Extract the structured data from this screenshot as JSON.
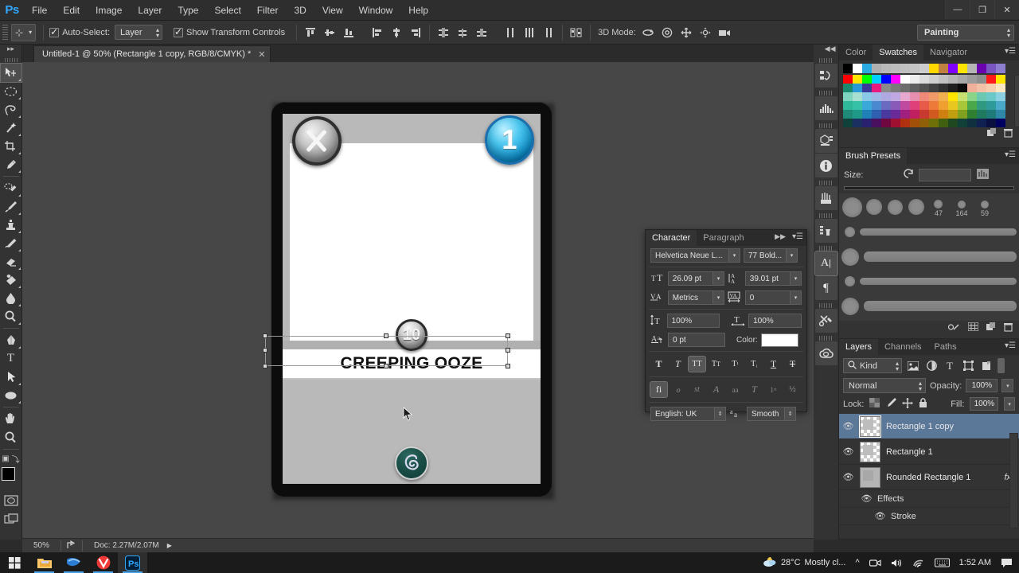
{
  "app": {
    "name": "Ps",
    "logo_color": "#31a8ff"
  },
  "menubar": {
    "items": [
      "File",
      "Edit",
      "Image",
      "Layer",
      "Type",
      "Select",
      "Filter",
      "3D",
      "View",
      "Window",
      "Help"
    ]
  },
  "window_controls": {
    "minimize": "—",
    "restore": "❐",
    "close": "✕"
  },
  "options_bar": {
    "auto_select_label": "Auto-Select:",
    "auto_select_checked": true,
    "auto_select_target": "Layer",
    "show_transform_label": "Show Transform Controls",
    "show_transform_checked": true,
    "align_icons": [
      "align-top-edges-icon",
      "align-vertical-centers-icon",
      "align-bottom-edges-icon",
      "align-left-edges-icon",
      "align-horizontal-centers-icon",
      "align-right-edges-icon"
    ],
    "distribute_icons": [
      "distribute-top-edges-icon",
      "distribute-vertical-centers-icon",
      "distribute-bottom-edges-icon",
      "distribute-left-edges-icon",
      "distribute-horizontal-centers-icon",
      "distribute-right-edges-icon"
    ],
    "auto_align_icon": "auto-align-layers-icon",
    "mode_3d_label": "3D Mode:",
    "mode_3d_icons": [
      "rotate-3d-icon",
      "roll-3d-icon",
      "pan-3d-icon",
      "slide-3d-icon",
      "scale-3d-icon"
    ],
    "workspace": "Painting"
  },
  "document_tab": {
    "title": "Untitled-1 @ 50% (Rectangle 1 copy, RGB/8/CMYK) *",
    "close": "✕"
  },
  "toolbar": {
    "tools": [
      {
        "name": "move-tool",
        "glyph": "✥",
        "active": true
      },
      {
        "name": "elliptical-marquee-tool",
        "glyph": "◯"
      },
      {
        "name": "lasso-tool",
        "glyph": "✒"
      },
      {
        "name": "magic-wand-tool",
        "glyph": "✷"
      },
      {
        "name": "crop-tool",
        "glyph": "⌗"
      },
      {
        "name": "eyedropper-tool",
        "glyph": "✎"
      },
      {
        "name": "spot-healing-brush-tool",
        "glyph": "⌗"
      },
      {
        "name": "brush-tool",
        "glyph": "🖌"
      },
      {
        "name": "clone-stamp-tool",
        "glyph": "⎙"
      },
      {
        "name": "history-brush-tool",
        "glyph": "⌇"
      },
      {
        "name": "eraser-tool",
        "glyph": "▱"
      },
      {
        "name": "gradient-tool",
        "glyph": "◧"
      },
      {
        "name": "blur-tool",
        "glyph": "💧"
      },
      {
        "name": "dodge-tool",
        "glyph": "◉"
      },
      {
        "name": "pen-tool",
        "glyph": "✑"
      },
      {
        "name": "type-tool",
        "glyph": "T"
      },
      {
        "name": "path-selection-tool",
        "glyph": "➤"
      },
      {
        "name": "ellipse-shape-tool",
        "glyph": "⬭"
      },
      {
        "name": "hand-tool",
        "glyph": "✋"
      },
      {
        "name": "zoom-tool",
        "glyph": "🔍"
      }
    ],
    "foreground_color": "#000000",
    "background_color": "#ffffff",
    "quick_mask_icon": "quick-mask-icon",
    "screen_mode_icon": "screen-mode-icon",
    "default_colors_icon": "default-colors-icon",
    "swap_colors_icon": "swap-colors-icon"
  },
  "canvas": {
    "card": {
      "name": "CREEPING OOZE",
      "cost": "1",
      "power": "10",
      "type_icon": "crossed-swords-icon",
      "faction_icon": "ooze-spiral-icon",
      "art_area_color": "#ffffff",
      "frame_color": "#0c0c0c",
      "border_color": "#b9b9b9"
    },
    "selection": {
      "handles": 8,
      "cursor_icon": "text-cursor-icon"
    }
  },
  "status_bar": {
    "zoom": "50%",
    "share_icon": "share-icon",
    "doc_info": "Doc: 2.27M/2.07M",
    "expand_icon": "▶"
  },
  "icon_dock": {
    "collapse_icon": "◀◀",
    "buttons": [
      {
        "name": "history-panel-icon",
        "glyph": "↺"
      },
      {
        "name": "histogram-panel-icon",
        "glyph": "▥"
      },
      {
        "name": "3d-panel-icon",
        "glyph": "◰"
      },
      {
        "name": "info-panel-icon",
        "glyph": "ⓘ"
      },
      {
        "name": "brush-panel-icon",
        "glyph": "🖌"
      },
      {
        "name": "clone-source-panel-icon",
        "glyph": "▤"
      },
      {
        "name": "character-panel-icon",
        "glyph": "A"
      },
      {
        "name": "paragraph-panel-icon",
        "glyph": "¶"
      },
      {
        "name": "tool-presets-panel-icon",
        "glyph": "✂"
      },
      {
        "name": "creative-cloud-icon",
        "glyph": "◎"
      }
    ]
  },
  "swatches_panel": {
    "tabs": [
      "Color",
      "Swatches",
      "Navigator"
    ],
    "active_tab": "Swatches",
    "recent_colors": [
      "#000000",
      "#ffffff",
      "#29abe2",
      "#b0b0b0",
      "#b8b8b8",
      "#bdbdbd",
      "#c0c0c0",
      "#c4c4c4",
      "#cccccc",
      "#ffd800",
      "#c08040",
      "#7f00ff",
      "#ffe400",
      "#b5b5b5",
      "#6a00b0",
      "#7a56c2",
      "#8e7ed0"
    ],
    "grid": [
      [
        "#ff0000",
        "#ffe400",
        "#00ff00",
        "#00d0ff",
        "#0000ff",
        "#ff00ff",
        "#ffffff",
        "#ededed",
        "#dcdcdc",
        "#cfcfcf",
        "#c2c2c2",
        "#b5b5b5",
        "#a8a8a8",
        "#9b9b9b",
        "#8e8e8e",
        "#ff1a1a",
        "#ffe400"
      ],
      [
        "#1a8a6e",
        "#2a9ad6",
        "#3a3a9a",
        "#e8197f",
        "#8a8a8a",
        "#7a7a7a",
        "#6e6e6e",
        "#5f5f5f",
        "#515151",
        "#414141",
        "#313131",
        "#1f1f1f",
        "#0c0c0c",
        "#f0b09a",
        "#f5c0a8",
        "#f7cdb0",
        "#fae6c0"
      ],
      [
        "#7fd4c0",
        "#a7e0d0",
        "#8ac8e8",
        "#9fb8e8",
        "#b0a8e0",
        "#c0a8e0",
        "#e8a8d0",
        "#e88fb0",
        "#f08a78",
        "#f09a6a",
        "#f0b050",
        "#ffe400",
        "#c8e070",
        "#8ad48a",
        "#6ac8b0",
        "#6ac8c8",
        "#8ad0e0"
      ],
      [
        "#2fb89a",
        "#35c0a8",
        "#3aa8d8",
        "#4a88d0",
        "#6a6ac0",
        "#8a5ab8",
        "#c04aa0",
        "#e0407a",
        "#e85a4a",
        "#ee7a3a",
        "#f0a030",
        "#e8c820",
        "#a8c83a",
        "#4aa84a",
        "#2f9a80",
        "#2f9a9a",
        "#4aa8c8"
      ],
      [
        "#1f8a78",
        "#1f9a88",
        "#2080b8",
        "#2f60b0",
        "#4a3aa0",
        "#6a2a98",
        "#a02080",
        "#c02060",
        "#c83a2f",
        "#d05a20",
        "#d08010",
        "#c0a010",
        "#80a020",
        "#2f8030",
        "#1f7a60",
        "#1f7a7a",
        "#2f88a8"
      ],
      [
        "#10403a",
        "#1a3060",
        "#2a2070",
        "#4a1060",
        "#700840",
        "#a01030",
        "#b03010",
        "#a05008",
        "#906008",
        "#707008",
        "#406010",
        "#204820",
        "#104038",
        "#103040",
        "#102050",
        "#0a1040",
        "#000060"
      ]
    ],
    "new_swatch_icon": "new-swatch-icon",
    "delete_icon": "trash-icon"
  },
  "brush_presets_panel": {
    "tab": "Brush Presets",
    "size_label": "Size:",
    "reset_icon": "reset-icon",
    "size_value": "",
    "toggle_icon": "brush-panel-toggle-icon",
    "preset_numbers": [
      "47",
      "164",
      "59"
    ],
    "footer_icons": [
      "new-brush-preset-icon",
      "brush-grid-icon",
      "duplicate-icon",
      "trash-icon"
    ]
  },
  "character_panel": {
    "tabs": [
      "Character",
      "Paragraph"
    ],
    "active_tab": "Character",
    "collapse_icon": "▶▶",
    "menu_icon": "panel-menu-icon",
    "font_family": "Helvetica Neue L...",
    "font_style": "77 Bold...",
    "font_size_icon": "font-size-icon",
    "font_size": "26.09 pt",
    "leading_icon": "leading-icon",
    "leading": "39.01 pt",
    "kerning_icon": "kerning-icon",
    "kerning": "Metrics",
    "tracking_icon": "tracking-icon",
    "tracking": "0",
    "vertical_scale_icon": "vertical-scale-icon",
    "vertical_scale": "100%",
    "horizontal_scale_icon": "horizontal-scale-icon",
    "horizontal_scale": "100%",
    "baseline_icon": "baseline-shift-icon",
    "baseline_shift": "0 pt",
    "color_label": "Color:",
    "color_value": "#ffffff",
    "style_buttons": [
      {
        "name": "faux-bold-button",
        "glyph": "T",
        "on": false
      },
      {
        "name": "faux-italic-button",
        "glyph": "T",
        "on": false
      },
      {
        "name": "all-caps-button",
        "glyph": "TT",
        "on": true
      },
      {
        "name": "small-caps-button",
        "glyph": "Tᴛ",
        "on": false
      },
      {
        "name": "superscript-button",
        "glyph": "T¹",
        "on": false
      },
      {
        "name": "subscript-button",
        "glyph": "T₁",
        "on": false
      },
      {
        "name": "underline-button",
        "glyph": "T",
        "on": false
      },
      {
        "name": "strikethrough-button",
        "glyph": "T",
        "on": false
      }
    ],
    "ligature_buttons": [
      {
        "name": "standard-ligatures-button",
        "glyph": "fi",
        "on": true
      },
      {
        "name": "contextual-alternates-button",
        "glyph": "ℴ",
        "on": false
      },
      {
        "name": "discretionary-ligatures-button",
        "glyph": "st",
        "on": false
      },
      {
        "name": "swash-button",
        "glyph": "𝒜",
        "on": false
      },
      {
        "name": "old-style-button",
        "glyph": "aa",
        "on": false
      },
      {
        "name": "titling-alternates-button",
        "glyph": "T",
        "on": false
      },
      {
        "name": "ordinals-button",
        "glyph": "1ˢᵗ",
        "on": false
      },
      {
        "name": "fractions-button",
        "glyph": "½",
        "on": false
      }
    ],
    "language": "English: UK",
    "antialias_icon": "anti-alias-icon",
    "antialias": "Smooth"
  },
  "layers_panel": {
    "tabs": [
      "Layers",
      "Channels",
      "Paths"
    ],
    "active_tab": "Layers",
    "menu_icon": "panel-menu-icon",
    "filter_kind": "Kind",
    "filter_search_icon": "search-icon",
    "filter_icons": [
      "filter-pixel-icon",
      "filter-adjustment-icon",
      "filter-type-icon",
      "filter-shape-icon",
      "filter-smart-object-icon"
    ],
    "filter_toggle_icon": "filter-toggle-icon",
    "blend_mode": "Normal",
    "opacity_label": "Opacity:",
    "opacity": "100%",
    "lock_label": "Lock:",
    "lock_icons": [
      "lock-transparent-pixels-icon",
      "lock-image-pixels-icon",
      "lock-position-icon",
      "lock-all-icon"
    ],
    "fill_label": "Fill:",
    "fill": "100%",
    "layers": [
      {
        "name": "Rectangle 1 copy",
        "visible": true,
        "selected": true,
        "fx": false,
        "thumb": "transparent"
      },
      {
        "name": "Rectangle 1",
        "visible": true,
        "selected": false,
        "fx": false,
        "thumb": "transparent"
      },
      {
        "name": "Rounded Rectangle 1",
        "visible": true,
        "selected": false,
        "fx": true,
        "thumb": "solid"
      }
    ],
    "effects_label": "Effects",
    "stroke_label": "Stroke",
    "eye_glyph": "👁",
    "fx_glyph": "fx"
  },
  "taskbar": {
    "start_icon": "windows-start-icon",
    "items": [
      {
        "name": "file-explorer-icon",
        "running": true,
        "active": false
      },
      {
        "name": "mail-icon",
        "running": true,
        "active": false
      },
      {
        "name": "vivaldi-browser-icon",
        "running": true,
        "active": false
      },
      {
        "name": "photoshop-icon",
        "running": true,
        "active": true
      }
    ],
    "tray": {
      "weather_icon": "weather-partly-cloudy-night-icon",
      "temperature": "28°C",
      "condition": "Mostly cl...",
      "chevron_icon": "^",
      "meet_now_icon": "meet-now-icon",
      "volume_icon": "volume-icon",
      "network_icon": "wifi-icon",
      "keyboard_icon": "keyboard-icon",
      "clock": "1:52 AM",
      "notifications_icon": "notifications-icon"
    }
  }
}
